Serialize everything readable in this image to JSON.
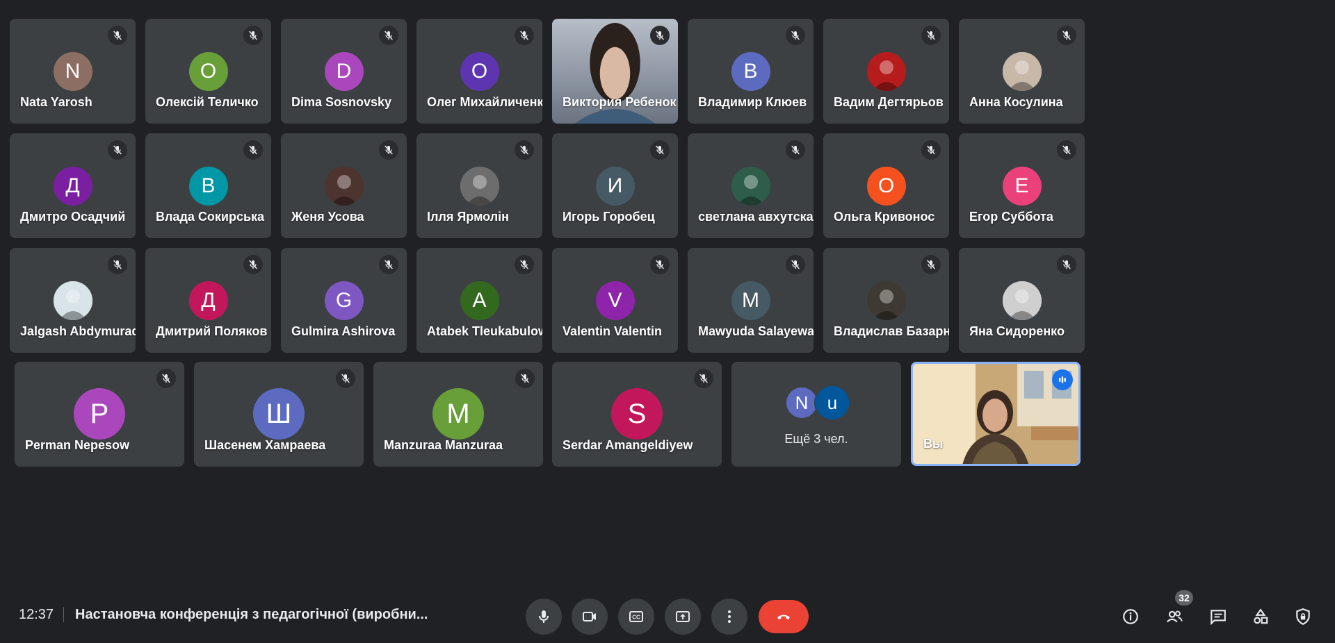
{
  "colors": {
    "background": "#202124",
    "tile": "#3c4043",
    "end_call": "#ea4335",
    "self_highlight": "#8ab4f8"
  },
  "participants_row1": [
    {
      "name": "Nata Yarosh",
      "initial": "N",
      "color": "#8d6e63",
      "type": "letter"
    },
    {
      "name": "Олексій Теличко",
      "initial": "О",
      "color": "#689f38",
      "type": "letter"
    },
    {
      "name": "Dima Sosnovsky",
      "initial": "D",
      "color": "#ab47bc",
      "type": "letter"
    },
    {
      "name": "Олег Михайличенко",
      "initial": "О",
      "color": "#5e35b1",
      "type": "letter"
    },
    {
      "name": "Виктория Ребенок",
      "initial": "",
      "color": "#9aa0ab",
      "type": "video"
    },
    {
      "name": "Владимир Клюев",
      "initial": "В",
      "color": "#5c6bc0",
      "type": "letter"
    },
    {
      "name": "Вадим Дегтярьов",
      "initial": "",
      "color": "#b71c1c",
      "type": "photo"
    },
    {
      "name": "Анна Косулина",
      "initial": "",
      "color": "#c8b8a8",
      "type": "photo"
    }
  ],
  "participants_row2": [
    {
      "name": "Дмитро Осадчий",
      "initial": "Д",
      "color": "#7b1fa2",
      "type": "letter"
    },
    {
      "name": "Влада Сокирська",
      "initial": "В",
      "color": "#0097a7",
      "type": "letter"
    },
    {
      "name": "Женя Усова",
      "initial": "",
      "color": "#4e342e",
      "type": "photo"
    },
    {
      "name": "Ілля Ярмолін",
      "initial": "",
      "color": "#6d6d6d",
      "type": "photo"
    },
    {
      "name": "Игорь Горобец",
      "initial": "И",
      "color": "#455a64",
      "type": "letter"
    },
    {
      "name": "светлана авхутская",
      "initial": "",
      "color": "#2e5d4b",
      "type": "photo"
    },
    {
      "name": "Ольга Кривонос",
      "initial": "О",
      "color": "#f4511e",
      "type": "letter"
    },
    {
      "name": "Егор Суббота",
      "initial": "Е",
      "color": "#ec407a",
      "type": "letter"
    }
  ],
  "participants_row3": [
    {
      "name": "Jalgash Abdymuradov",
      "initial": "",
      "color": "#d9e4e8",
      "type": "photo"
    },
    {
      "name": "Дмитрий Поляков",
      "initial": "Д",
      "color": "#c2185b",
      "type": "letter"
    },
    {
      "name": "Gulmira Ashirova",
      "initial": "G",
      "color": "#7e57c2",
      "type": "letter"
    },
    {
      "name": "Atabek Tleukabulow",
      "initial": "A",
      "color": "#33691e",
      "type": "letter"
    },
    {
      "name": "Valentin Valentin",
      "initial": "V",
      "color": "#8e24aa",
      "type": "letter"
    },
    {
      "name": "Mawyuda Salayewa",
      "initial": "M",
      "color": "#455a64",
      "type": "letter"
    },
    {
      "name": "Владислав Базарний",
      "initial": "",
      "color": "#3e3a33",
      "type": "photo"
    },
    {
      "name": "Яна Сидоренко",
      "initial": "",
      "color": "#cfcfcf",
      "type": "photo"
    }
  ],
  "participants_row4": [
    {
      "name": "Perman Nepesow",
      "initial": "P",
      "color": "#ab47bc",
      "type": "letter"
    },
    {
      "name": "Шасенем Хамраева",
      "initial": "Ш",
      "color": "#5c6bc0",
      "type": "letter"
    },
    {
      "name": "Manzuraa Manzuraa",
      "initial": "M",
      "color": "#689f38",
      "type": "letter"
    },
    {
      "name": "Serdar Amangeldiyew",
      "initial": "S",
      "color": "#c2185b",
      "type": "letter"
    }
  ],
  "more_tile": {
    "label": "Ещё 3 чел.",
    "avatar1_initial": "N",
    "avatar1_color": "#5c6bc0",
    "avatar2_initial": "u",
    "avatar2_color": "#01579b"
  },
  "self_tile": {
    "name": "Вы"
  },
  "toolbar": {
    "time": "12:37",
    "meeting_title": "Настановча конференція з педагогічної (виробни...",
    "participants_count": "32",
    "icons": {
      "mic": "microphone-icon",
      "camera": "video-camera-icon",
      "captions": "closed-captions-icon",
      "present": "present-screen-icon",
      "more": "more-options-icon",
      "end": "end-call-icon",
      "info": "info-icon",
      "people": "people-icon",
      "chat": "chat-icon",
      "activities": "activities-icon",
      "host": "host-controls-icon"
    }
  }
}
